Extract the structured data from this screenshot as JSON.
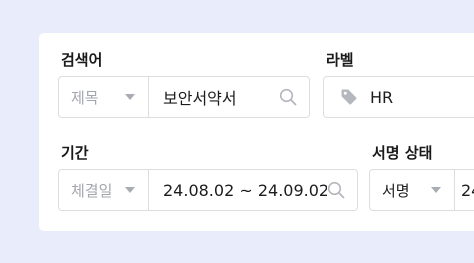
{
  "search": {
    "label": "검색어",
    "scope": "제목",
    "value": "보안서약서",
    "icon": "search-icon"
  },
  "label_filter": {
    "label": "라벨",
    "value": "HR",
    "icon": "tag-icon"
  },
  "period": {
    "label": "기간",
    "type": "체결일",
    "value": "24.08.02 ~ 24.09.02",
    "icon": "search-icon"
  },
  "sign_status": {
    "label": "서명 상태",
    "value": "서명",
    "value2": "24"
  },
  "colors": {
    "background": "#e9ecfa",
    "panel": "#ffffff",
    "border": "#dcdde1",
    "muted_text": "#a3a6ad",
    "icon": "#b4b7bd"
  }
}
